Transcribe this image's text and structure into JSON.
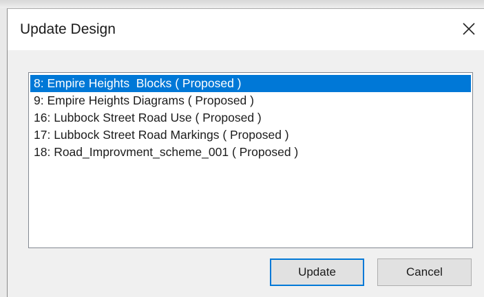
{
  "dialog": {
    "title": "Update Design",
    "close_icon": "close-icon"
  },
  "design_list": {
    "items": [
      {
        "label": "8: Empire Heights  Blocks ( Proposed )",
        "selected": true
      },
      {
        "label": "9: Empire Heights Diagrams ( Proposed )",
        "selected": false
      },
      {
        "label": "16: Lubbock Street Road Use ( Proposed )",
        "selected": false
      },
      {
        "label": "17: Lubbock Street Road Markings ( Proposed )",
        "selected": false
      },
      {
        "label": "18: Road_Improvment_scheme_001 ( Proposed )",
        "selected": false
      }
    ]
  },
  "buttons": {
    "update_label": "Update",
    "cancel_label": "Cancel"
  },
  "colors": {
    "selection": "#0078d7",
    "default_button_border": "#0078d7",
    "dialog_background": "#f0f0f0"
  }
}
